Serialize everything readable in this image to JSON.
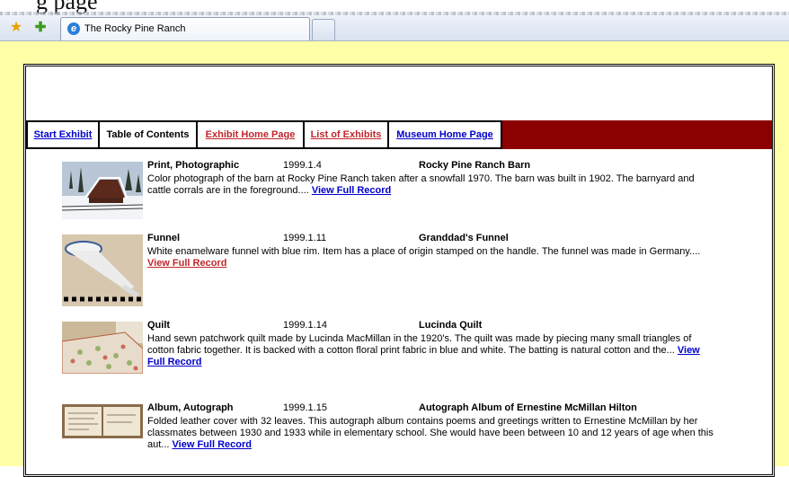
{
  "browser": {
    "header_text": "g  page",
    "tab_title": "The Rocky Pine Ranch"
  },
  "nav": {
    "items": [
      {
        "label": "Start Exhibit"
      },
      {
        "label": "Table of Contents"
      },
      {
        "label": "Exhibit Home Page"
      },
      {
        "label": "List of Exhibits"
      },
      {
        "label": "Museum Home Page"
      }
    ]
  },
  "records": [
    {
      "type": "Print, Photographic",
      "id": "1999.1.4",
      "title": "Rocky Pine Ranch Barn",
      "description": "Color photograph of the barn at Rocky Pine Ranch taken after a snowfall 1970. The barn was built in 1902. The barnyard and cattle corrals are in the foreground....",
      "link": "View Full Record"
    },
    {
      "type": "Funnel",
      "id": "1999.1.11",
      "title": "Granddad's Funnel",
      "description": "White enamelware funnel with blue rim. Item has a place of origin stamped on the handle. The funnel was made in Germany....",
      "link": "View Full Record"
    },
    {
      "type": "Quilt",
      "id": "1999.1.14",
      "title": "Lucinda Quilt",
      "description": "Hand sewn patchwork quilt made by Lucinda MacMillan in the 1920's. The quilt was made by piecing many small triangles of cotton fabric together. It is backed with a cotton floral print fabric in blue and white. The batting is natural cotton and the...",
      "link": "View Full Record"
    },
    {
      "type": "Album, Autograph",
      "id": "1999.1.15",
      "title": "Autograph Album of Ernestine McMillan Hilton",
      "description": "Folded leather cover with 32 leaves. This autograph album contains poems and greetings written to Ernestine McMillan by her classmates between 1930 and 1933 while in elementary school. She would have been between 10 and 12 years of age when this aut...",
      "link": "View Full Record"
    }
  ],
  "colors": {
    "page_bg": "#ffffa8",
    "nav_bar": "#8b0000",
    "link_blue": "#0000cc",
    "link_red": "#c0272d"
  }
}
